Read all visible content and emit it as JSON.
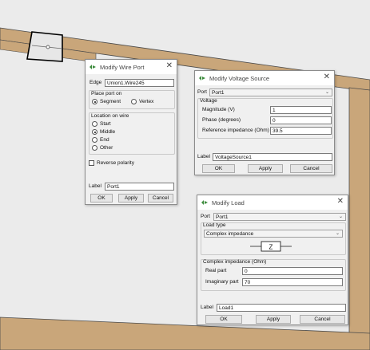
{
  "wire_port": {
    "title": "Modify Wire Port",
    "edge_label": "Edge",
    "edge_value": "Union1.Wire245",
    "place_port_title": "Place port on",
    "place_segment": "Segment",
    "place_vertex": "Vertex",
    "location_title": "Location on wire",
    "loc_start": "Start",
    "loc_middle": "Middle",
    "loc_end": "End",
    "loc_other": "Other",
    "reverse_polarity": "Reverse polarity",
    "label_label": "Label",
    "label_value": "Port1",
    "ok": "OK",
    "apply": "Apply",
    "cancel": "Cancel"
  },
  "voltage_source": {
    "title": "Modify Voltage Source",
    "port_label": "Port",
    "port_value": "Port1",
    "voltage_title": "Voltage",
    "magnitude_label": "Magnitude (V)",
    "magnitude_value": "1",
    "phase_label": "Phase (degrees)",
    "phase_value": "0",
    "refimp_label": "Reference impedance (Ohm)",
    "refimp_value": "39.5",
    "label_label": "Label",
    "label_value": "VoltageSource1",
    "ok": "OK",
    "apply": "Apply",
    "cancel": "Cancel"
  },
  "load": {
    "title": "Modify Load",
    "port_label": "Port",
    "port_value": "Port1",
    "load_type_title": "Load type",
    "load_type_value": "Complex impedance",
    "z_symbol": "Z",
    "complex_title": "Complex impedance (Ohm)",
    "real_label": "Real part",
    "real_value": "0",
    "imag_label": "Imaginary part",
    "imag_value": "70",
    "label_label": "Label",
    "label_value": "Load1",
    "ok": "OK",
    "apply": "Apply",
    "cancel": "Cancel"
  },
  "colors": {
    "frame": "#c9a67a",
    "background": "#ebebeb",
    "dialog": "#f0f0f0"
  }
}
